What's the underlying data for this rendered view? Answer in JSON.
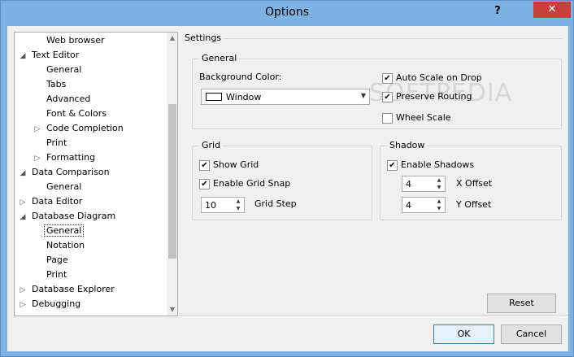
{
  "window": {
    "title": "Options",
    "help": "?",
    "close": "✕"
  },
  "tree": {
    "items": [
      {
        "label": "Web browser",
        "level": 2,
        "arrow": ""
      },
      {
        "label": "Text Editor",
        "level": 1,
        "arrow": "◢"
      },
      {
        "label": "General",
        "level": 2,
        "arrow": ""
      },
      {
        "label": "Tabs",
        "level": 2,
        "arrow": ""
      },
      {
        "label": "Advanced",
        "level": 2,
        "arrow": ""
      },
      {
        "label": "Font & Colors",
        "level": 2,
        "arrow": ""
      },
      {
        "label": "Code Completion",
        "level": 2,
        "arrow": "▷"
      },
      {
        "label": "Print",
        "level": 2,
        "arrow": ""
      },
      {
        "label": "Formatting",
        "level": 2,
        "arrow": "▷"
      },
      {
        "label": "Data Comparison",
        "level": 1,
        "arrow": "◢"
      },
      {
        "label": "General",
        "level": 2,
        "arrow": ""
      },
      {
        "label": "Data Editor",
        "level": 1,
        "arrow": "▷"
      },
      {
        "label": "Database Diagram",
        "level": 1,
        "arrow": "◢"
      },
      {
        "label": "General",
        "level": 2,
        "arrow": "",
        "selected": true
      },
      {
        "label": "Notation",
        "level": 2,
        "arrow": ""
      },
      {
        "label": "Page",
        "level": 2,
        "arrow": ""
      },
      {
        "label": "Print",
        "level": 2,
        "arrow": ""
      },
      {
        "label": "Database Explorer",
        "level": 1,
        "arrow": "▷"
      },
      {
        "label": "Debugging",
        "level": 1,
        "arrow": "▷"
      }
    ]
  },
  "settings": {
    "heading": "Settings",
    "general": {
      "title": "General",
      "bg_color_label": "Background Color:",
      "bg_color_value": "Window",
      "auto_scale": "Auto Scale on Drop",
      "preserve_routing": "Preserve Routing",
      "wheel_scale": "Wheel Scale"
    },
    "grid": {
      "title": "Grid",
      "show_grid": "Show Grid",
      "enable_snap": "Enable Grid Snap",
      "step_value": "10",
      "step_label": "Grid Step"
    },
    "shadow": {
      "title": "Shadow",
      "enable": "Enable Shadows",
      "x_value": "4",
      "x_label": "X Offset",
      "y_value": "4",
      "y_label": "Y Offset"
    },
    "reset": "Reset"
  },
  "footer": {
    "ok": "OK",
    "cancel": "Cancel"
  },
  "watermark": "SOFTPEDIA",
  "checks": {
    "auto_scale": true,
    "preserve_routing": true,
    "wheel_scale": false,
    "show_grid": true,
    "enable_snap": true,
    "enable_shadows": true
  }
}
